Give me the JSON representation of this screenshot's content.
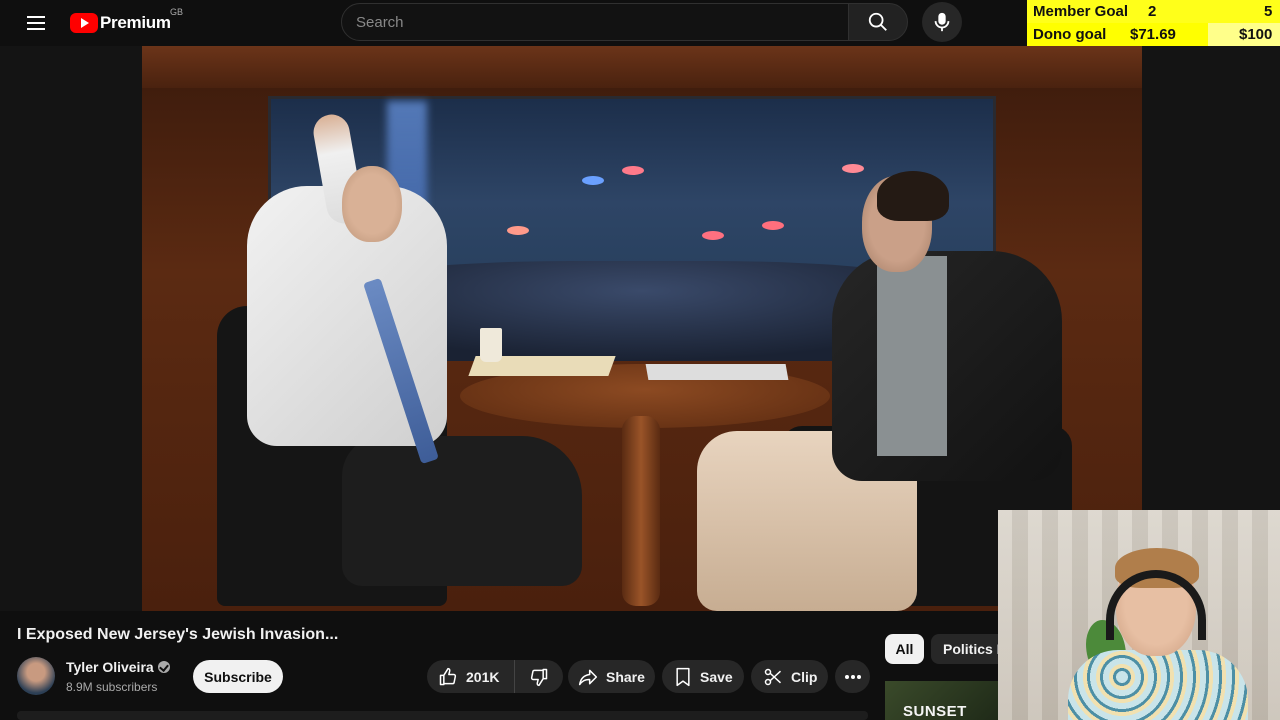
{
  "header": {
    "logo_text": "Premium",
    "country_code": "GB",
    "search_placeholder": "Search",
    "search_value": ""
  },
  "goals": {
    "member_label": "Member Goal",
    "member_current": "2",
    "member_target": "5",
    "dono_label": "Dono goal",
    "dono_current": "$71.69",
    "dono_target": "$100",
    "dono_progress": 0.7169
  },
  "video": {
    "title": "I Exposed New Jersey's Jewish Invasion...",
    "channel_name": "Tyler Oliveira",
    "subscribers": "8.9M subscribers",
    "subscribe_label": "Subscribe",
    "likes": "201K",
    "share_label": "Share",
    "save_label": "Save",
    "clip_label": "Clip"
  },
  "sidebar": {
    "chips": [
      "All",
      "Politics N"
    ],
    "thumb_text": "SUNSET"
  },
  "colors": {
    "goal_yellow": "#ffff00",
    "logo_red": "#ff0000",
    "background": "#0f0f0f"
  },
  "icons": [
    "hamburger-menu-icon",
    "youtube-logo-icon",
    "search-icon",
    "microphone-icon",
    "thumbs-up-icon",
    "thumbs-down-icon",
    "share-icon",
    "save-icon",
    "clip-icon",
    "more-icon",
    "verified-icon"
  ]
}
